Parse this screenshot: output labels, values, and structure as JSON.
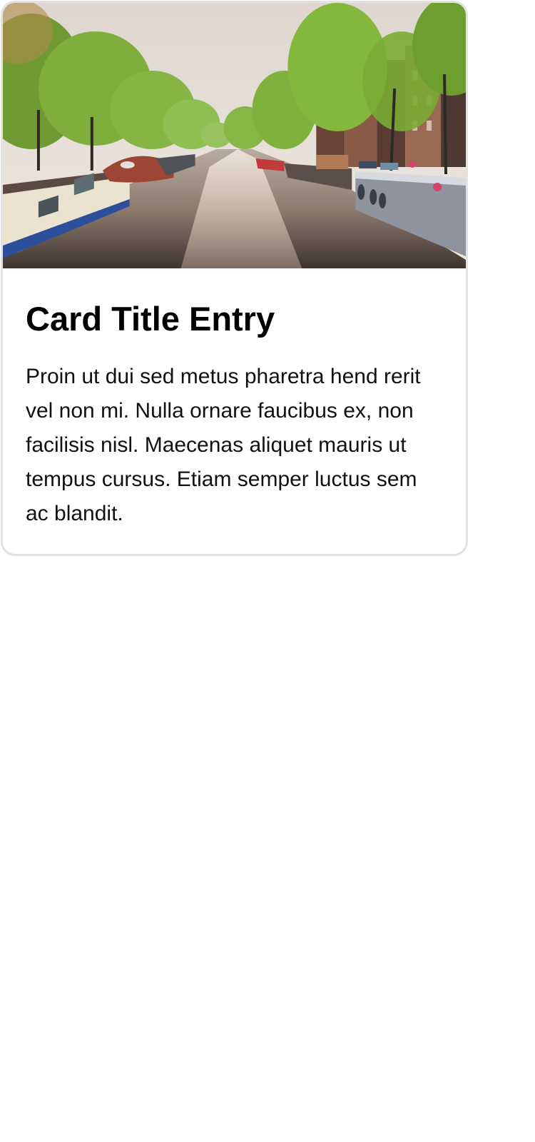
{
  "card": {
    "image": {
      "icon": "canal-photo",
      "colors": {
        "sky": "#e6dfd8",
        "water": "#8e7c70",
        "trees": "#6f9e3a",
        "buildings": "#7a4a3c"
      }
    },
    "title": "Card Title Entry",
    "text": "Proin ut dui sed metus pharetra hend rerit vel non mi. Nulla ornare faucibus ex, non facilisis nisl. Maecenas aliquet mauris ut tempus cursus. Etiam semper luctus sem ac blandit."
  }
}
